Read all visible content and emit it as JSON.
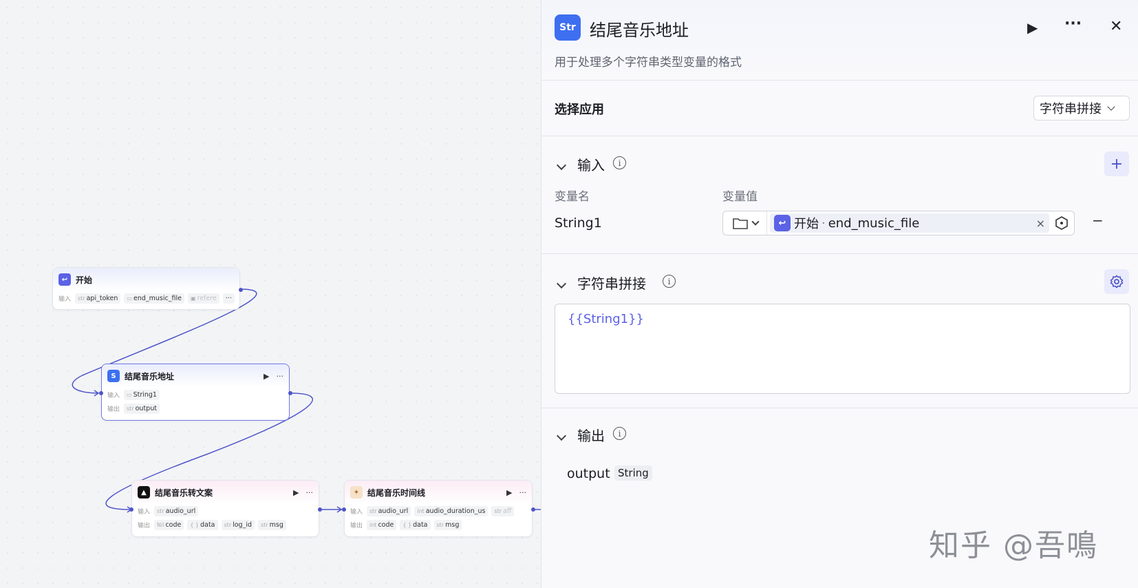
{
  "canvas": {
    "nodes": {
      "start": {
        "title": "开始",
        "input_label": "输入",
        "inputs": [
          {
            "type": "str",
            "name": "api_token"
          },
          {
            "type": "folder",
            "name": "end_music_file"
          },
          {
            "type": "img",
            "name": "refere"
          }
        ],
        "more": "···"
      },
      "end_music_address": {
        "title": "结尾音乐地址",
        "input_label": "输入",
        "output_label": "输出",
        "inputs": [
          {
            "type": "folder",
            "name": "String1"
          }
        ],
        "outputs": [
          {
            "type": "str",
            "name": "output"
          }
        ],
        "run": "▶",
        "more": "···"
      },
      "end_music_to_text": {
        "title": "结尾音乐转文案",
        "input_label": "输入",
        "output_label": "输出",
        "inputs": [
          {
            "type": "str",
            "name": "audio_url"
          }
        ],
        "outputs": [
          {
            "type": "Nil",
            "name": "code"
          },
          {
            "type": "{ }",
            "name": "data"
          },
          {
            "type": "str",
            "name": "log_id"
          },
          {
            "type": "str",
            "name": "msg"
          }
        ],
        "run": "▶",
        "more": "···"
      },
      "end_music_timeline": {
        "title": "结尾音乐时间线",
        "input_label": "输入",
        "output_label": "输出",
        "inputs": [
          {
            "type": "str",
            "name": "audio_url"
          },
          {
            "type": "int",
            "name": "audio_duration_us"
          },
          {
            "type": "str",
            "name": "aff"
          }
        ],
        "outputs": [
          {
            "type": "int",
            "name": "code"
          },
          {
            "type": "{ }",
            "name": "data"
          },
          {
            "type": "str",
            "name": "msg"
          }
        ],
        "run": "▶",
        "more": "···"
      }
    }
  },
  "panel": {
    "icon_text": "Str",
    "title": "结尾音乐地址",
    "description": "用于处理多个字符串类型变量的格式",
    "run_icon": "▶",
    "more_icon": "···",
    "close_icon": "✕",
    "select_app": {
      "label": "选择应用",
      "value": "字符串拼接"
    },
    "input_section": {
      "title": "输入",
      "col_name": "变量名",
      "col_value": "变量值",
      "add_icon": "+",
      "row": {
        "name": "String1",
        "ref_source": "开始",
        "ref_sep": "·",
        "ref_var": "end_music_file",
        "clear_icon": "×",
        "remove_icon": "−"
      }
    },
    "concat_section": {
      "title": "字符串拼接",
      "template": "{{String1}}"
    },
    "output_section": {
      "title": "输出",
      "name": "output",
      "type": "String"
    }
  },
  "watermark": "知乎 @吾鳴",
  "colors": {
    "accent": "#4e55c9",
    "panel_icon_bg": "#3d6ff0",
    "edge": "#4e55c9"
  }
}
